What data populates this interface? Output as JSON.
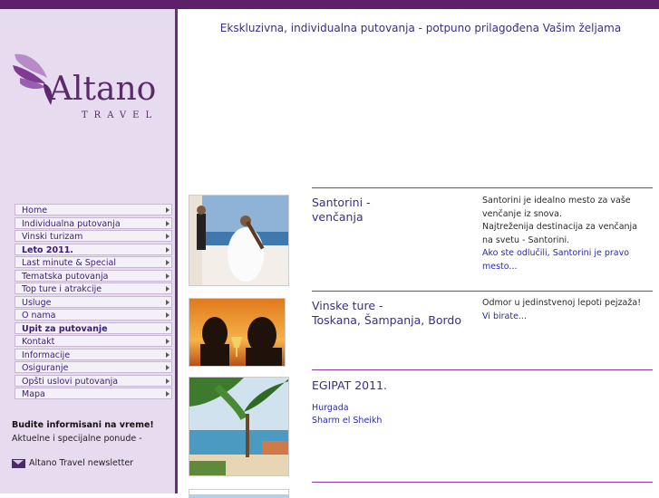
{
  "header": {
    "tagline": "Ekskluzivna, individualna putovanja - potpuno prilagođena Vašim željama"
  },
  "logo": {
    "name": "Altano",
    "sub": "TRAVEL"
  },
  "nav": [
    {
      "label": "Home",
      "bold": false
    },
    {
      "label": "Individualna putovanja",
      "bold": false
    },
    {
      "label": "Vinski turizam",
      "bold": false
    },
    {
      "label": "Leto 2011.",
      "bold": true
    },
    {
      "label": "Last minute & Special",
      "bold": false
    },
    {
      "label": "Tematska putovanja",
      "bold": false
    },
    {
      "label": "Top ture i atrakcije",
      "bold": false
    },
    {
      "label": "Usluge",
      "bold": false
    },
    {
      "label": "O nama",
      "bold": false
    },
    {
      "label": "Upit za putovanje",
      "bold": true
    },
    {
      "label": "Kontakt",
      "bold": false
    },
    {
      "label": "Informacije",
      "bold": false
    },
    {
      "label": "Osiguranje",
      "bold": false
    },
    {
      "label": "Opšti uslovi putovanja",
      "bold": false
    },
    {
      "label": "Mapa",
      "bold": false
    }
  ],
  "sidebar": {
    "news_title": "Budite informisani na vreme!",
    "news_text": "Aktuelne i specijalne ponude -",
    "newsletter": "Altano Travel newsletter"
  },
  "offers": [
    {
      "title_1": "Santorini -",
      "title_2": "venčanja",
      "desc": [
        "Santorini je idealno mesto za vaše",
        "venčanje iz snova.",
        "Najtreženija destinacija za venčanja",
        "na svetu - Santorini."
      ],
      "link": "Ako ste odlučili, Santorini je pravo mesto..."
    },
    {
      "title_1": "Vinske ture -",
      "title_2": "Toskana, Šampanja, Bordo",
      "desc": [
        "Odmor u jedinstvenoj lepoti pejzaža!"
      ],
      "link": "Vi birate..."
    },
    {
      "title_1": "EGIPAT 2011.",
      "subs": [
        "Hurgada",
        "Sharm el Sheikh"
      ]
    }
  ],
  "colors": {
    "accent": "#5e1f6b",
    "sidebar_bg": "#e7dcef",
    "link": "#2a2aaa",
    "title": "#3a2d8a"
  }
}
